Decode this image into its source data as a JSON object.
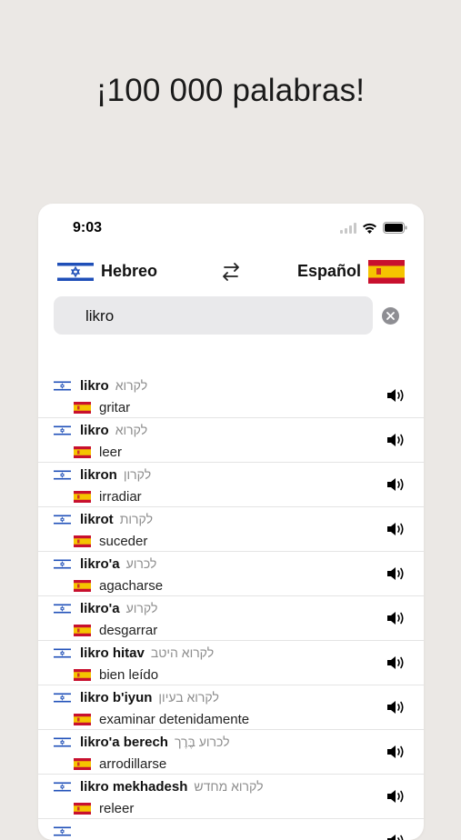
{
  "headline": "¡100 000 palabras!",
  "status": {
    "time": "9:03"
  },
  "languages": {
    "source": "Hebreo",
    "target": "Español"
  },
  "search": {
    "query": "likro"
  },
  "results": [
    {
      "term": "likro",
      "hebrew": "לקרוא",
      "translation": "gritar"
    },
    {
      "term": "likro",
      "hebrew": "לקרוא",
      "translation": "leer"
    },
    {
      "term": "likron",
      "hebrew": "לקרון",
      "translation": "irradiar"
    },
    {
      "term": "likrot",
      "hebrew": "לקרות",
      "translation": "suceder"
    },
    {
      "term": "likro'a",
      "hebrew": "לכרוע",
      "translation": "agacharse"
    },
    {
      "term": "likro'a",
      "hebrew": "לקרוע",
      "translation": "desgarrar"
    },
    {
      "term": "likro hitav",
      "hebrew": "לקרוא היטב",
      "translation": "bien leído"
    },
    {
      "term": "likro b'iyun",
      "hebrew": "לקרוא בעיון",
      "translation": "examinar detenidamente"
    },
    {
      "term": "likro'a berech",
      "hebrew": "לכרוע בֶּרֶך",
      "translation": "arrodillarse"
    },
    {
      "term": "likro mekhadesh",
      "hebrew": "לקרוא מחדש",
      "translation": "releer"
    },
    {
      "term": "",
      "hebrew": "",
      "translation": ""
    }
  ],
  "colors": {
    "israel_blue": "#1f4fb8",
    "spain_red": "#c8102e",
    "spain_yellow": "#f5c400"
  }
}
